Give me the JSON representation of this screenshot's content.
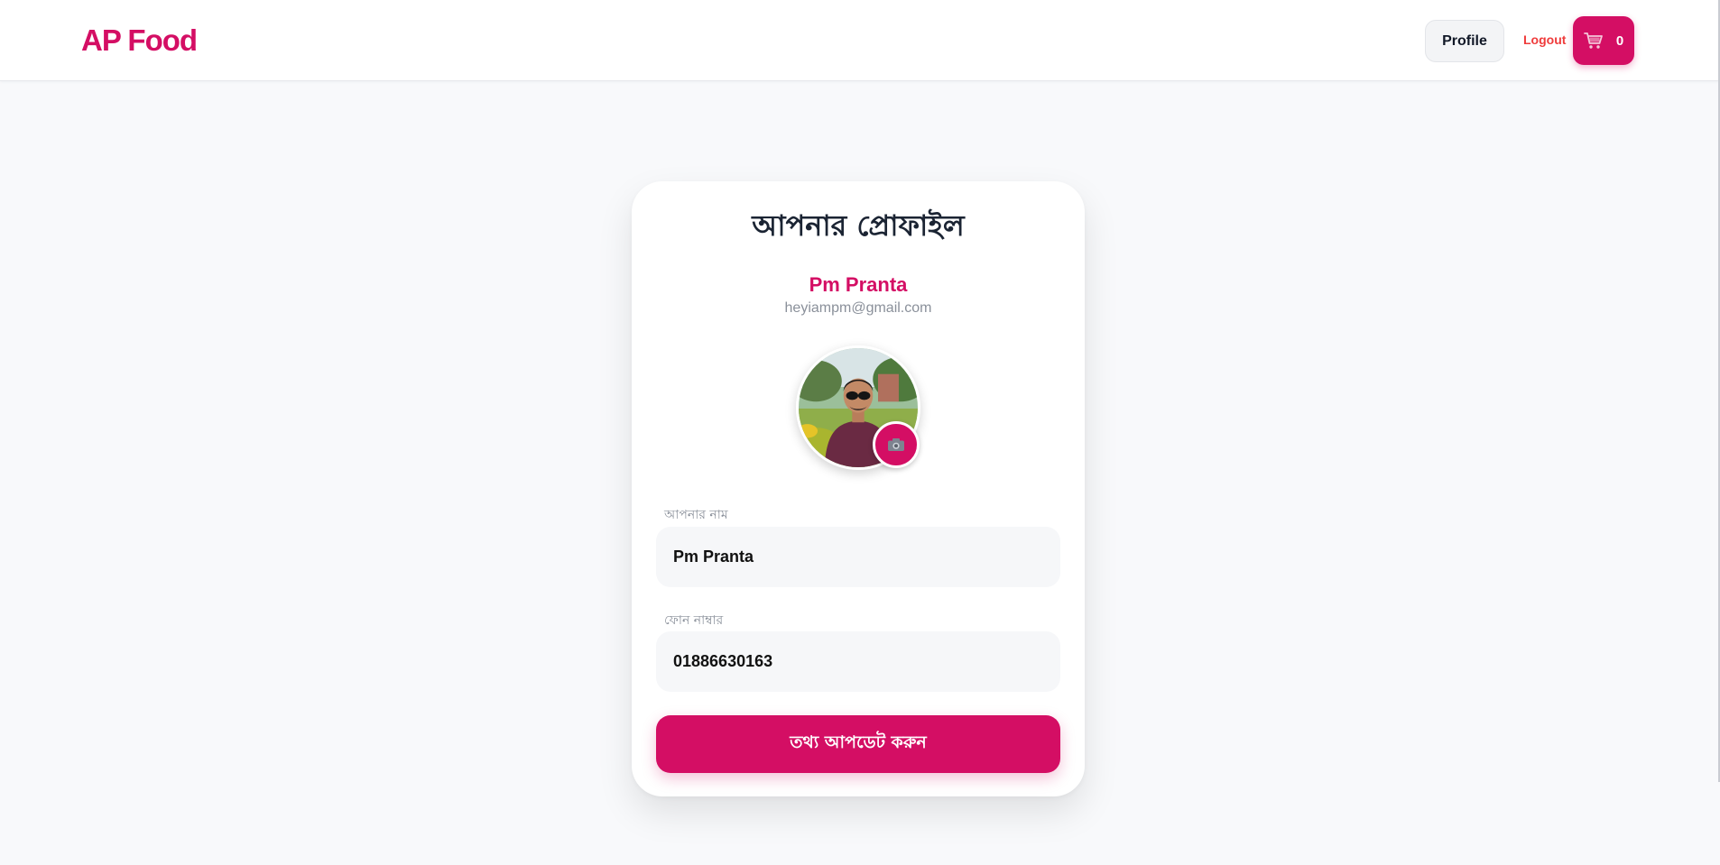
{
  "header": {
    "brand": "AP Food",
    "nav": {
      "profile_label": "Profile",
      "logout_label": "Logout",
      "cart_icon": "cart-icon",
      "cart_count": "0"
    }
  },
  "profile_card": {
    "title": "আপনার প্রোফাইল",
    "user": {
      "name": "Pm Pranta",
      "email": "heyiampm@gmail.com"
    },
    "avatar": {
      "icon": "avatar-photo",
      "upload_icon": "camera-icon"
    },
    "fields": {
      "name": {
        "label": "আপনার নাম",
        "value": "Pm Pranta"
      },
      "phone": {
        "label": "ফোন নাম্বার",
        "value": "01886630163"
      }
    },
    "submit_label": "তথ্য আপডেট করুন"
  },
  "colors": {
    "brand": "#d40e64",
    "logout": "#ef3b3b",
    "background": "#f8f9fb",
    "title": "#1b2433",
    "muted": "#8a909a"
  }
}
